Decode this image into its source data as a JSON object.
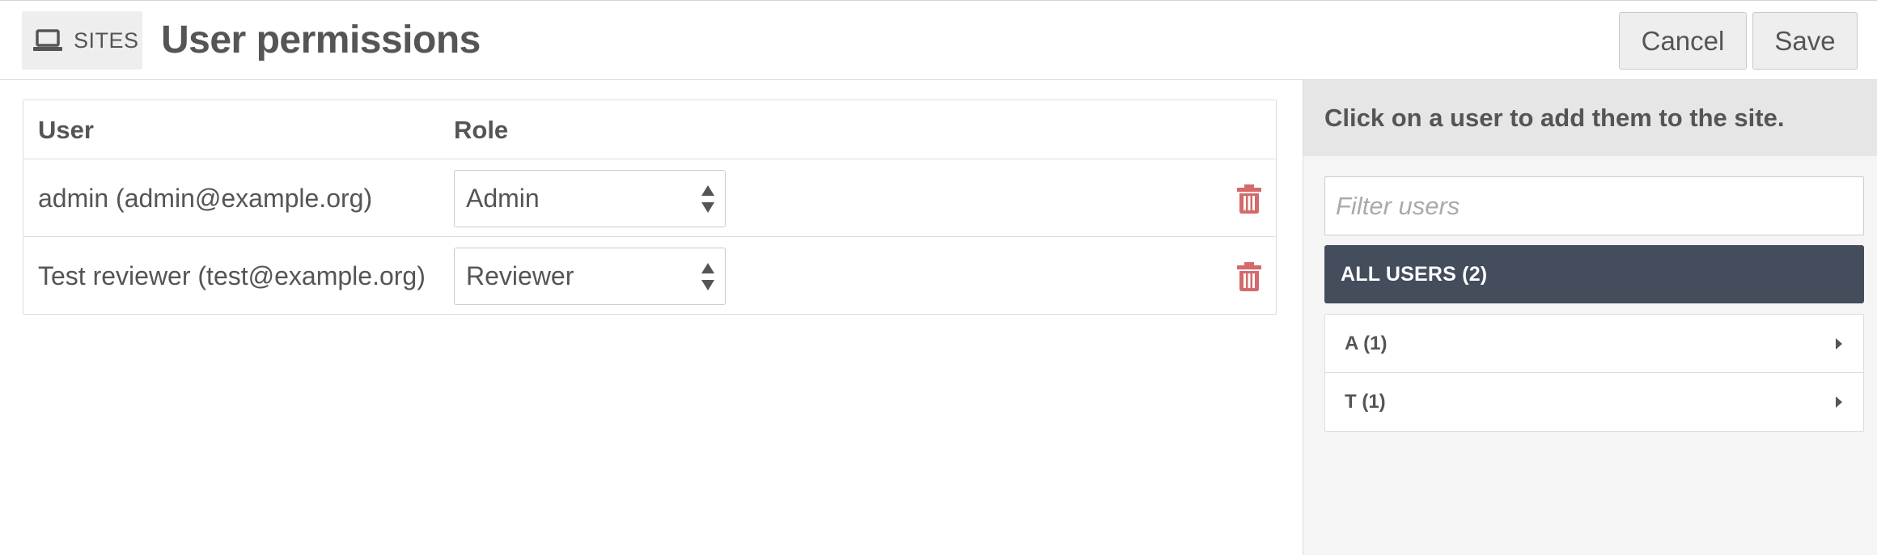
{
  "header": {
    "section_label": "SITES",
    "section_icon": "laptop-icon",
    "title": "User permissions",
    "cancel_label": "Cancel",
    "save_label": "Save"
  },
  "table": {
    "columns": [
      "User",
      "Role"
    ],
    "rows": [
      {
        "user": "admin (admin@example.org)",
        "role": "Admin"
      },
      {
        "user": "Test reviewer (test@example.org)",
        "role": "Reviewer"
      }
    ]
  },
  "panel": {
    "instruction": "Click on a user to add them to the site.",
    "filter_placeholder": "Filter users",
    "all_users_label": "ALL USERS (2)",
    "groups": [
      {
        "label": "A (1)"
      },
      {
        "label": "T (1)"
      }
    ]
  },
  "colors": {
    "accent_dark": "#434d5c",
    "delete": "#d46a6a",
    "panel_bg": "#f5f5f5",
    "text": "#555555"
  }
}
